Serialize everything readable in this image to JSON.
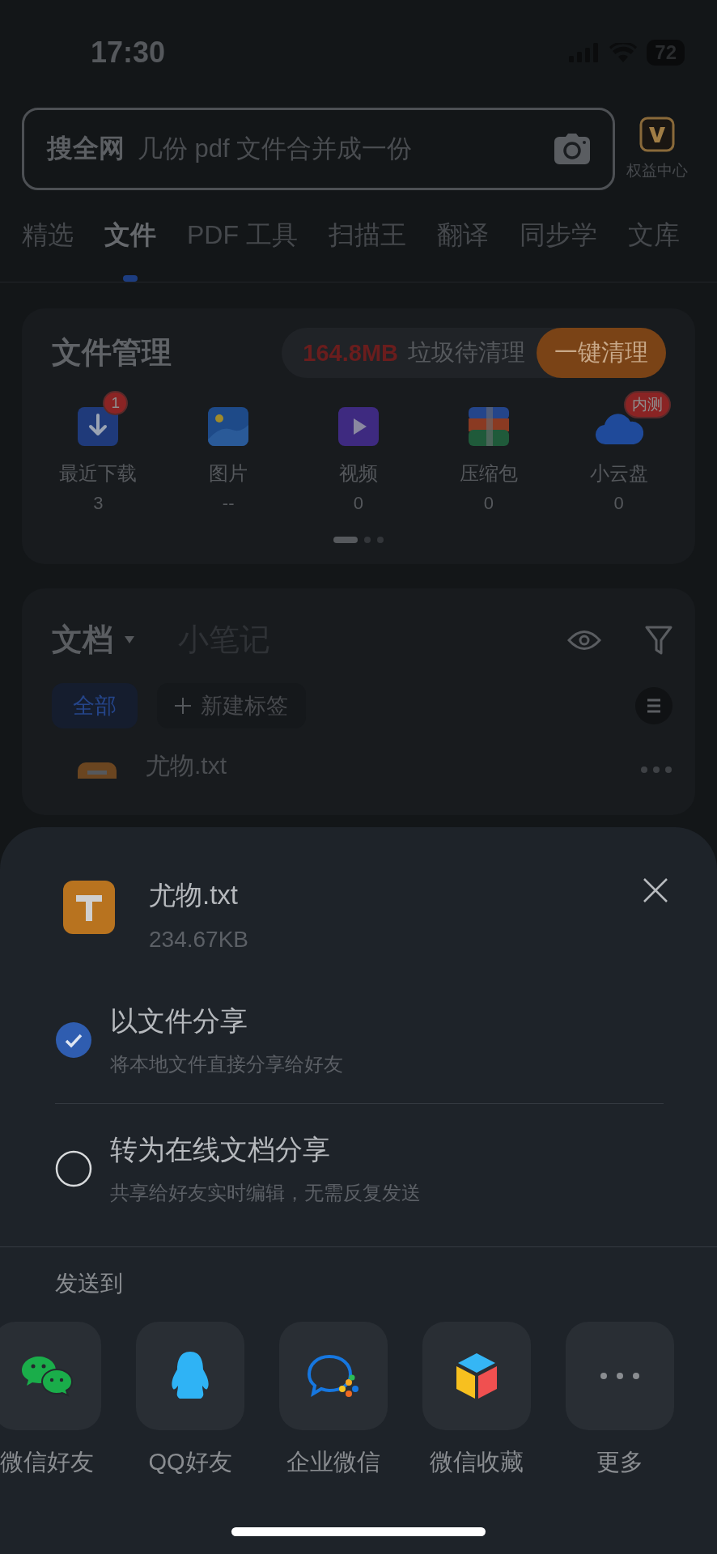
{
  "status_bar": {
    "time": "17:30",
    "battery": "72"
  },
  "search": {
    "scope": "搜全网",
    "placeholder": "几份 pdf 文件合并成一份"
  },
  "rights_center": {
    "label": "权益中心"
  },
  "tabs": [
    {
      "label": "精选",
      "selected": false
    },
    {
      "label": "文件",
      "selected": true
    },
    {
      "label": "PDF 工具",
      "selected": false
    },
    {
      "label": "扫描王",
      "selected": false
    },
    {
      "label": "翻译",
      "selected": false
    },
    {
      "label": "同步学",
      "selected": false
    },
    {
      "label": "文库",
      "selected": false
    }
  ],
  "file_manager": {
    "title": "文件管理",
    "junk_size": "164.8MB",
    "junk_label": "垃圾待清理",
    "clean_button": "一键清理",
    "items": [
      {
        "kind": "download",
        "label": "最近下载",
        "count": "3",
        "badge": "1"
      },
      {
        "kind": "image",
        "label": "图片",
        "count": "--"
      },
      {
        "kind": "video",
        "label": "视频",
        "count": "0"
      },
      {
        "kind": "archive",
        "label": "压缩包",
        "count": "0"
      },
      {
        "kind": "cloud",
        "label": "小云盘",
        "count": "0",
        "badge": "内测"
      }
    ],
    "pages": [
      {
        "selected": true
      },
      {
        "selected": false
      },
      {
        "selected": false
      }
    ]
  },
  "documents": {
    "tabs": [
      {
        "label": "文档",
        "selected": true
      },
      {
        "label": "小笔记",
        "selected": false
      }
    ],
    "chips": [
      {
        "kind": "tag",
        "label": "全部",
        "selected": true
      },
      {
        "kind": "add",
        "label": "新建标签",
        "selected": false
      }
    ],
    "file": {
      "name": "尤物.txt"
    }
  },
  "share_sheet": {
    "file_name": "尤物.txt",
    "file_size": "234.67KB",
    "options": [
      {
        "title": "以文件分享",
        "subtitle": "将本地文件直接分享给好友",
        "selected": true
      },
      {
        "title": "转为在线文档分享",
        "subtitle": "共享给好友实时编辑，无需反复发送",
        "selected": false
      }
    ],
    "send_to": "发送到",
    "targets": [
      {
        "kind": "wechat",
        "label": "微信好友"
      },
      {
        "kind": "qq",
        "label": "QQ好友"
      },
      {
        "kind": "wecom",
        "label": "企业微信"
      },
      {
        "kind": "favorites",
        "label": "微信收藏"
      },
      {
        "kind": "more",
        "label": "更多"
      }
    ]
  }
}
